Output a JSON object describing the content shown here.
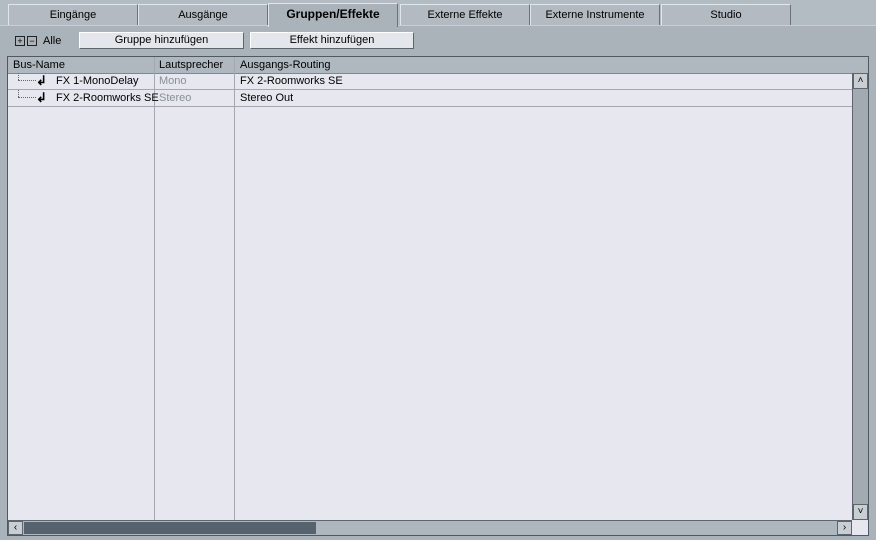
{
  "tabs": [
    "Eingänge",
    "Ausgänge",
    "Gruppen/Effekte",
    "Externe Effekte",
    "Externe Instrumente",
    "Studio"
  ],
  "active_tab": "Gruppen/Effekte",
  "toolbar": {
    "all_label": "Alle",
    "add_group": "Gruppe hinzufügen",
    "add_effect": "Effekt hinzufügen"
  },
  "table": {
    "columns": [
      "Bus-Name",
      "Lautsprecher",
      "Ausgangs-Routing"
    ],
    "rows": [
      {
        "name": "FX 1-MonoDelay",
        "speaker": "Mono",
        "routing": "FX 2-Roomworks SE"
      },
      {
        "name": "FX 2-Roomworks SE",
        "speaker": "Stereo",
        "routing": "Stereo Out"
      }
    ]
  },
  "scrollbar": {
    "horizontal_thumb_fraction": 0.36
  }
}
